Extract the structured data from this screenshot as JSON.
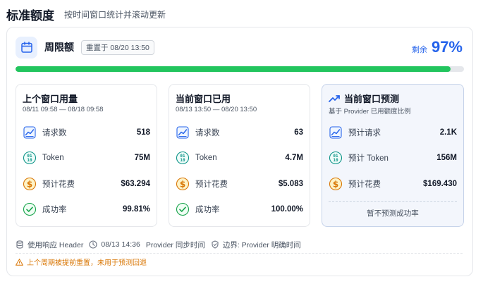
{
  "header": {
    "title": "标准额度",
    "subtitle": "按时间窗口统计并滚动更新"
  },
  "limit": {
    "title": "周限额",
    "reset_badge": "重置于 08/20 13:50",
    "remaining_label": "剩余",
    "remaining_percent": "97%",
    "progress_fraction": 0.97
  },
  "panels": [
    {
      "title": "上个窗口用量",
      "desc": "08/11 09:58 — 08/18 09:58",
      "rows": [
        {
          "icon": "chart-line-icon",
          "label": "请求数",
          "value": "518"
        },
        {
          "icon": "binary-icon",
          "label": "Token",
          "value": "75M"
        },
        {
          "icon": "dollar-icon",
          "label": "预计花费",
          "value": "$63.294"
        },
        {
          "icon": "check-circle-icon",
          "label": "成功率",
          "value": "99.81%"
        }
      ]
    },
    {
      "title": "当前窗口已用",
      "desc": "08/13 13:50 — 08/20 13:50",
      "rows": [
        {
          "icon": "chart-line-icon",
          "label": "请求数",
          "value": "63"
        },
        {
          "icon": "binary-icon",
          "label": "Token",
          "value": "4.7M"
        },
        {
          "icon": "dollar-icon",
          "label": "预计花费",
          "value": "$5.083"
        },
        {
          "icon": "check-circle-icon",
          "label": "成功率",
          "value": "100.00%"
        }
      ]
    },
    {
      "title": "当前窗口预测",
      "title_icon": "trending-up-icon",
      "desc": "基于 Provider 已用额度比例",
      "rows": [
        {
          "icon": "chart-line-icon",
          "label": "预计请求",
          "value": "2.1K"
        },
        {
          "icon": "binary-icon",
          "label": "预计 Token",
          "value": "156M"
        },
        {
          "icon": "dollar-icon",
          "label": "预计花费",
          "value": "$169.430"
        }
      ],
      "note": "暂不预测成功率"
    }
  ],
  "footer": {
    "source": "使用响应 Header",
    "sync_time": "08/13 14:36",
    "sync_label": "Provider 同步时间",
    "boundary": "边界: Provider 明确时间"
  },
  "warning": "上个周期被提前重置，未用于预测回退",
  "colors": {
    "accent": "#2563eb",
    "progress": "#22c55e",
    "warning": "#d97706",
    "success": "#16a34a",
    "money": "#d97706",
    "binary": "#0d9488"
  }
}
